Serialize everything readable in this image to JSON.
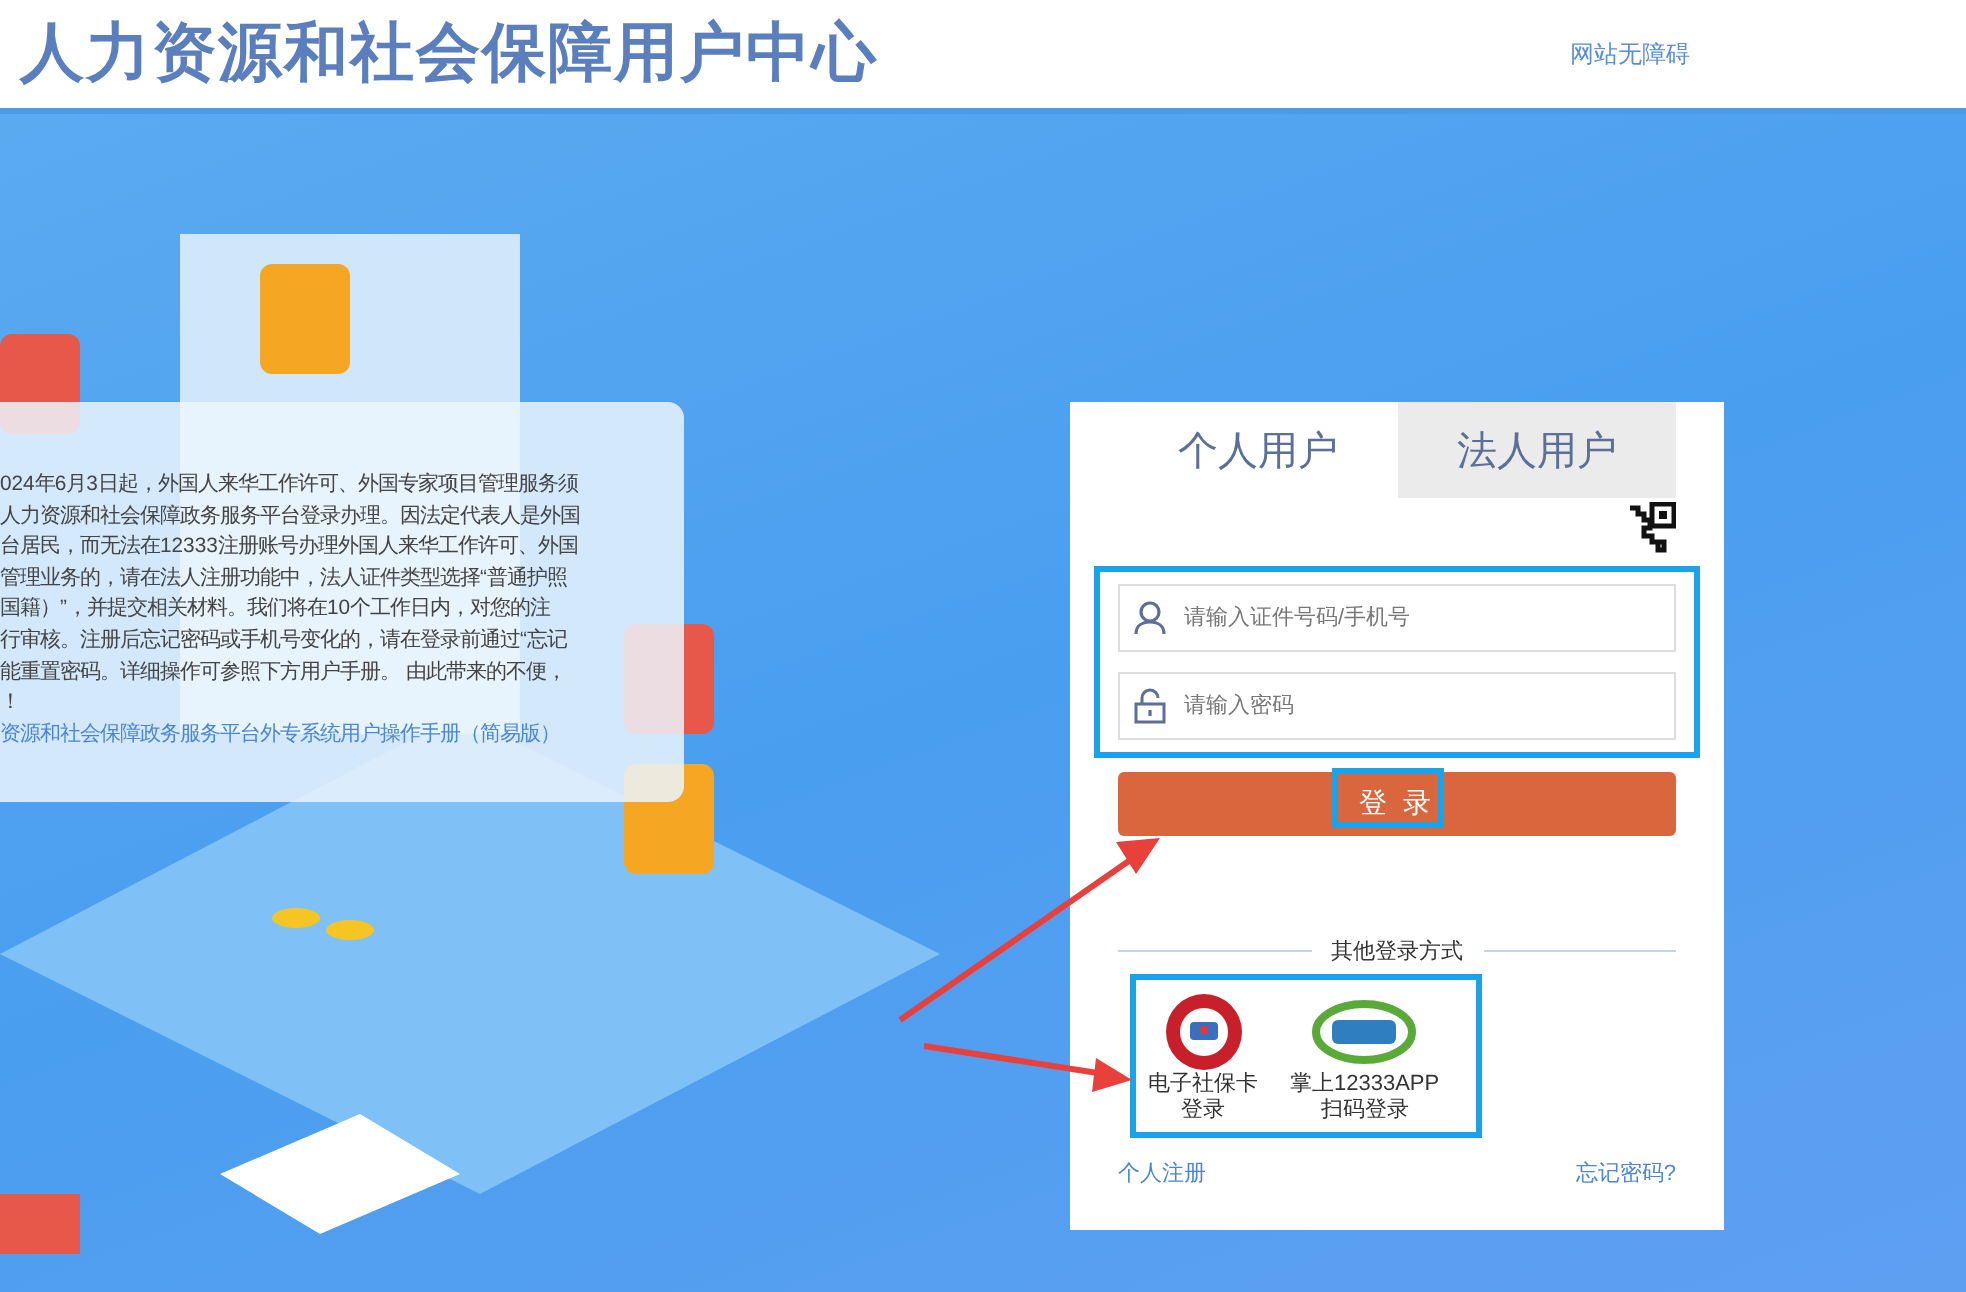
{
  "header": {
    "title": "人力资源和社会保障用户中心",
    "accessibility_link": "网站无障碍"
  },
  "notice": {
    "lines": [
      "024年6月3日起，外国人来华工作许可、外国专家项目管理服务须",
      "人力资源和社会保障政务服务平台登录办理。因法定代表人是外国",
      "台居民，而无法在12333注册账号办理外国人来华工作许可、外国",
      "管理业务的，请在法人注册功能中，法人证件类型选择“普通护照",
      "国籍）”，并提交相关材料。我们将在10个工作日内，对您的注",
      "行审核。注册后忘记密码或手机号变化的，请在登录前通过“忘记",
      "能重置密码。详细操作可参照下方用户手册。 由此带来的不便，",
      "！"
    ],
    "manual_link": "资源和社会保障政务服务平台外专系统用户操作手册（简易版）"
  },
  "login": {
    "tabs": [
      {
        "label": "个人用户",
        "selected": true
      },
      {
        "label": "法人用户",
        "selected": false
      }
    ],
    "fields": [
      {
        "kind": "user",
        "placeholder": "请输入证件号码/手机号"
      },
      {
        "kind": "password",
        "placeholder": "请输入密码"
      }
    ],
    "submit": "登 录",
    "other_title": "其他登录方式",
    "other_methods": [
      {
        "kind": "card",
        "lines": [
          "电子社保卡",
          "登录"
        ]
      },
      {
        "kind": "app",
        "lines": [
          "掌上12333APP",
          "扫码登录"
        ]
      }
    ],
    "register": "个人注册",
    "forgot": "忘记密码?"
  }
}
